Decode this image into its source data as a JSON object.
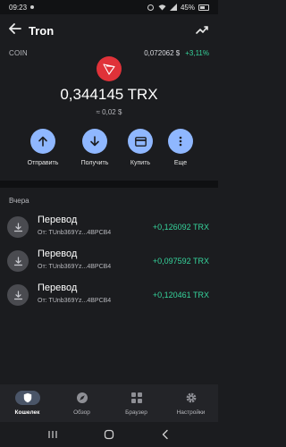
{
  "status_bar": {
    "time": "09:23",
    "battery": "45%"
  },
  "header": {
    "title": "Tron"
  },
  "coin": {
    "label": "COIN",
    "price": "0,072062 $",
    "change": "+3,11%"
  },
  "balance": {
    "amount": "0,344145 TRX",
    "fiat": "≈ 0,02 $"
  },
  "actions": [
    {
      "label": "Отправить",
      "icon": "arrow-up-icon"
    },
    {
      "label": "Получить",
      "icon": "arrow-down-icon"
    },
    {
      "label": "Купить",
      "icon": "card-icon"
    },
    {
      "label": "Еще",
      "icon": "more-vertical-icon"
    }
  ],
  "history": {
    "section_title": "Вчера",
    "items": [
      {
        "title": "Перевод",
        "from": "От: TUnb369Yz...4BPCB4",
        "amount": "+0,126092 TRX"
      },
      {
        "title": "Перевод",
        "from": "От: TUnb369Yz...4BPCB4",
        "amount": "+0,097592 TRX"
      },
      {
        "title": "Перевод",
        "from": "От: TUnb369Yz...4BPCB4",
        "amount": "+0,120461 TRX"
      }
    ]
  },
  "bottom_nav": [
    {
      "label": "Кошелек",
      "icon": "shield-icon",
      "active": true
    },
    {
      "label": "Обзор",
      "icon": "compass-icon",
      "active": false
    },
    {
      "label": "Браузер",
      "icon": "grid-icon",
      "active": false
    },
    {
      "label": "Настройки",
      "icon": "gear-icon",
      "active": false
    }
  ],
  "colors": {
    "background": "#1b1c1f",
    "accent": "#8fb7ff",
    "positive": "#36d49c",
    "tron_red": "#e03239"
  }
}
